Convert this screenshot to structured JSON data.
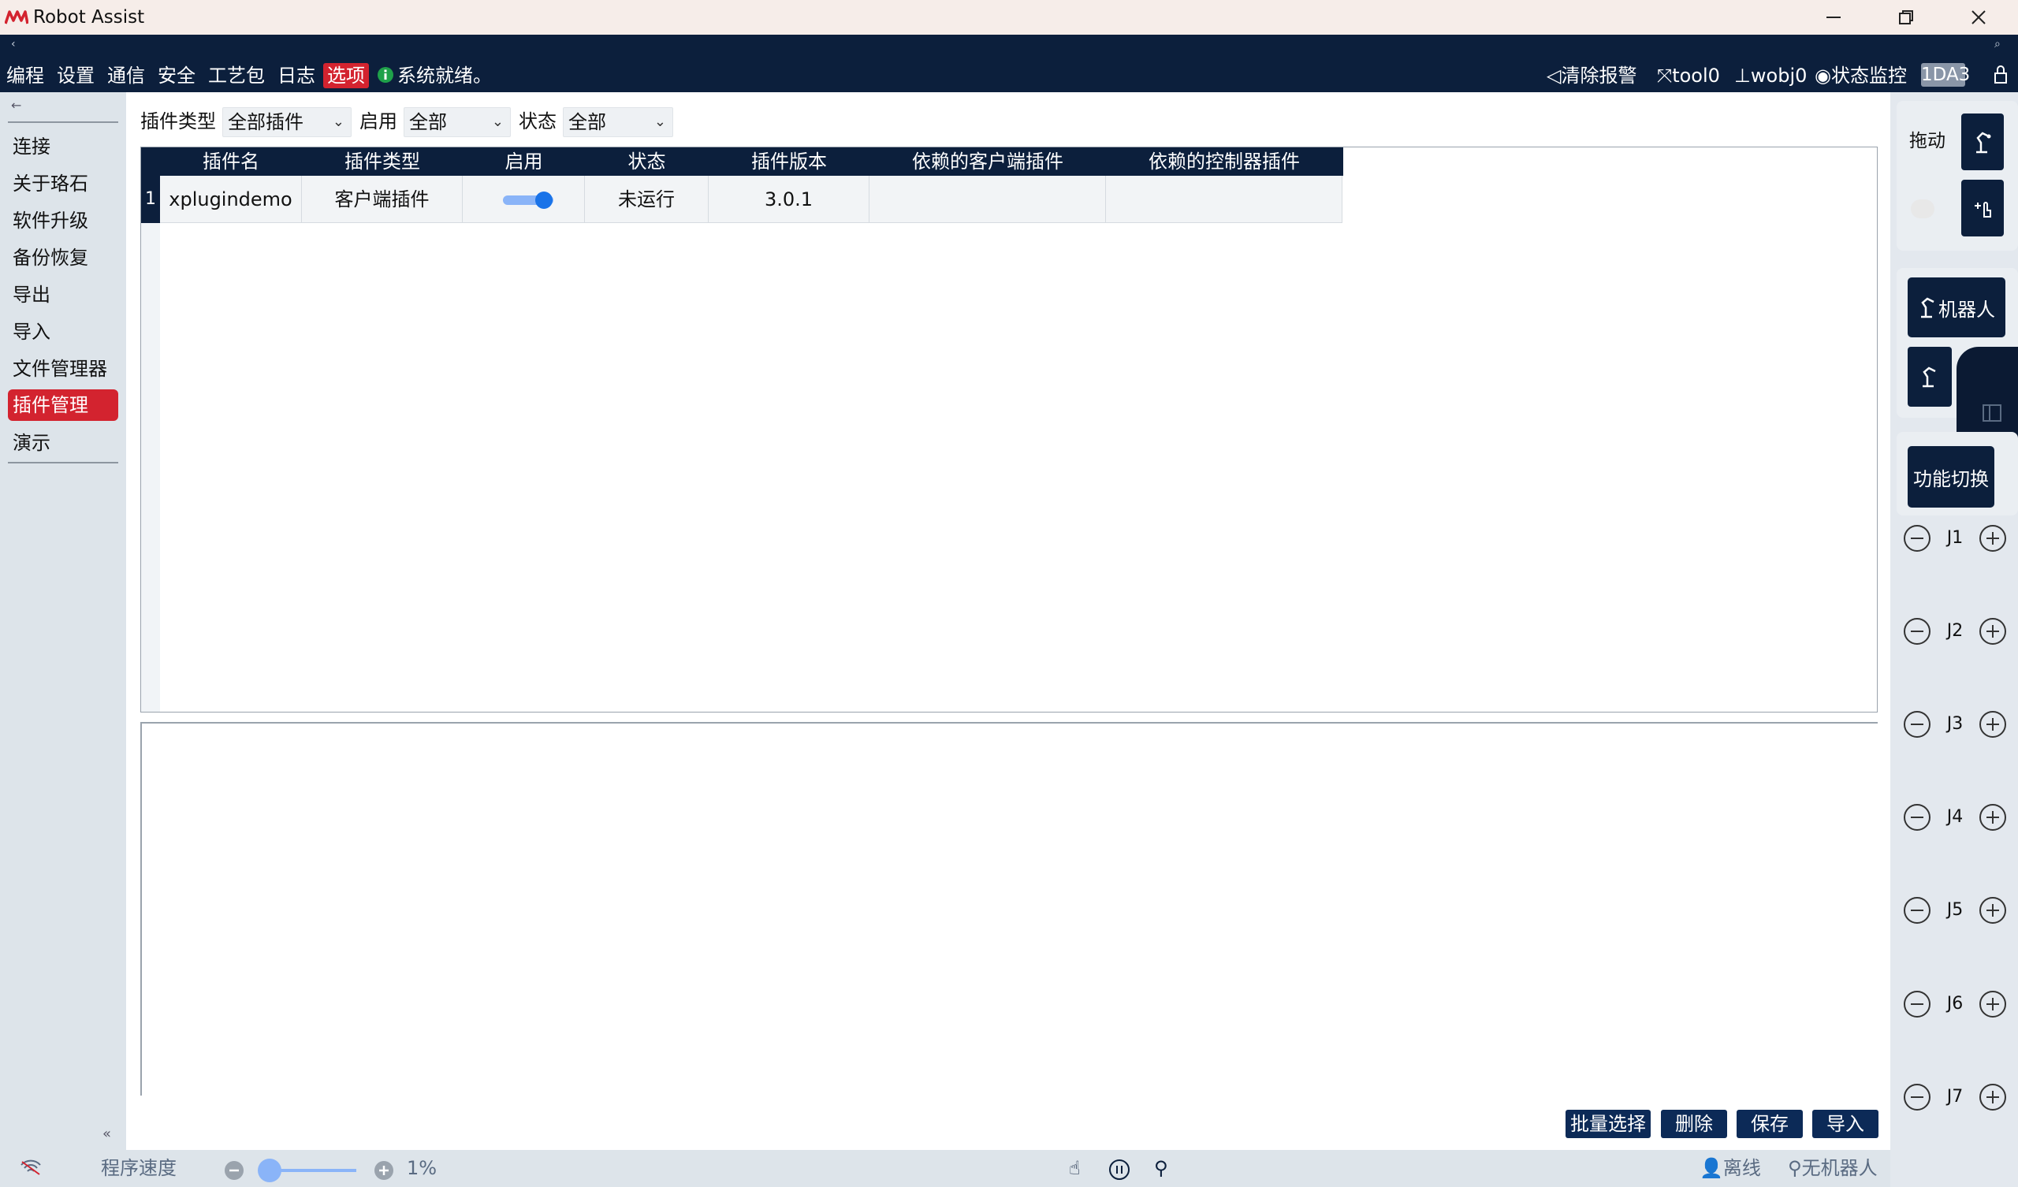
{
  "window": {
    "title": "Robot Assist",
    "minimize_icon": "minimize-icon",
    "maximize_icon": "restore-icon",
    "close_icon": "close-icon"
  },
  "topbar": {
    "menu": [
      "编程",
      "设置",
      "通信",
      "安全",
      "工艺包",
      "日志",
      "选项"
    ],
    "active_menu": "选项",
    "system_status": "系统就绪。",
    "clear_alarm": "清除报警",
    "tool": "tool0",
    "wobj": "wobj0",
    "state_monitor": "状态监控",
    "badge": "1DA3"
  },
  "sidebar": {
    "items": [
      "连接",
      "关于珞石",
      "软件升级",
      "备份恢复",
      "导出",
      "导入",
      "文件管理器",
      "插件管理",
      "演示"
    ],
    "active": "插件管理"
  },
  "filters": {
    "type_label": "插件类型",
    "type_value": "全部插件",
    "enable_label": "启用",
    "enable_value": "全部",
    "state_label": "状态",
    "state_value": "全部"
  },
  "table": {
    "columns": [
      "插件名",
      "插件类型",
      "启用",
      "状态",
      "插件版本",
      "依赖的客户端插件",
      "依赖的控制器插件"
    ],
    "rows": [
      {
        "index": "1",
        "name": "xplugindemo",
        "type": "客户端插件",
        "enabled": true,
        "state": "未运行",
        "version": "3.0.1",
        "client_deps": "",
        "controller_deps": ""
      }
    ]
  },
  "actions": {
    "batch_select": "批量选择",
    "delete": "删除",
    "save": "保存",
    "import": "导入"
  },
  "rightpanel": {
    "drag_label": "拖动",
    "robot_button": "机器人",
    "function_switch": "功能切换",
    "joints": [
      "J1",
      "J2",
      "J3",
      "J4",
      "J5",
      "J6",
      "J7"
    ]
  },
  "statusbar": {
    "program_speed_label": "程序速度",
    "speed_value": "1%",
    "speed_fraction": 0.01,
    "offline": "离线",
    "no_robot": "无机器人"
  },
  "colors": {
    "navy": "#0c1f3c",
    "accent_red": "#d3232f",
    "toggle_blue": "#1a73e8"
  }
}
